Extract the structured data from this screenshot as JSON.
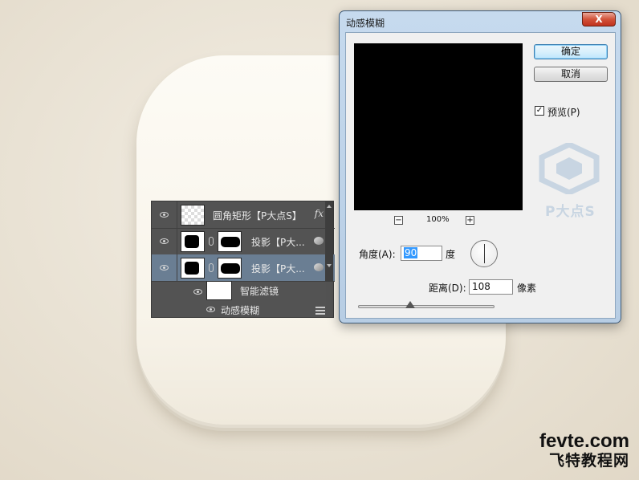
{
  "layers_panel": {
    "layers": [
      {
        "name": "圆角矩形【P大点S】",
        "effect_icon": "fx-icon"
      },
      {
        "name": "投影【P大...",
        "effect_icon": "smart-object-icon"
      },
      {
        "name": "投影【P大...",
        "effect_icon": "smart-object-icon",
        "selected": true
      }
    ],
    "smart_filters_label": "智能滤镜",
    "filter_name": "动感模糊"
  },
  "dialog": {
    "title": "动感模糊",
    "close_label": "X",
    "ok_label": "确定",
    "cancel_label": "取消",
    "preview_checkbox_label": "预览(P)",
    "preview_checked": true,
    "zoom_level": "100%",
    "zoom_minus": "−",
    "zoom_plus": "+",
    "angle_label": "角度(A):",
    "angle_value": "90",
    "angle_unit": "度",
    "distance_label": "距离(D):",
    "distance_value": "108",
    "distance_unit": "像素",
    "watermark_text": "P大点S"
  },
  "site_watermark": {
    "domain": "fevte.com",
    "chinese": "飞特教程网"
  }
}
